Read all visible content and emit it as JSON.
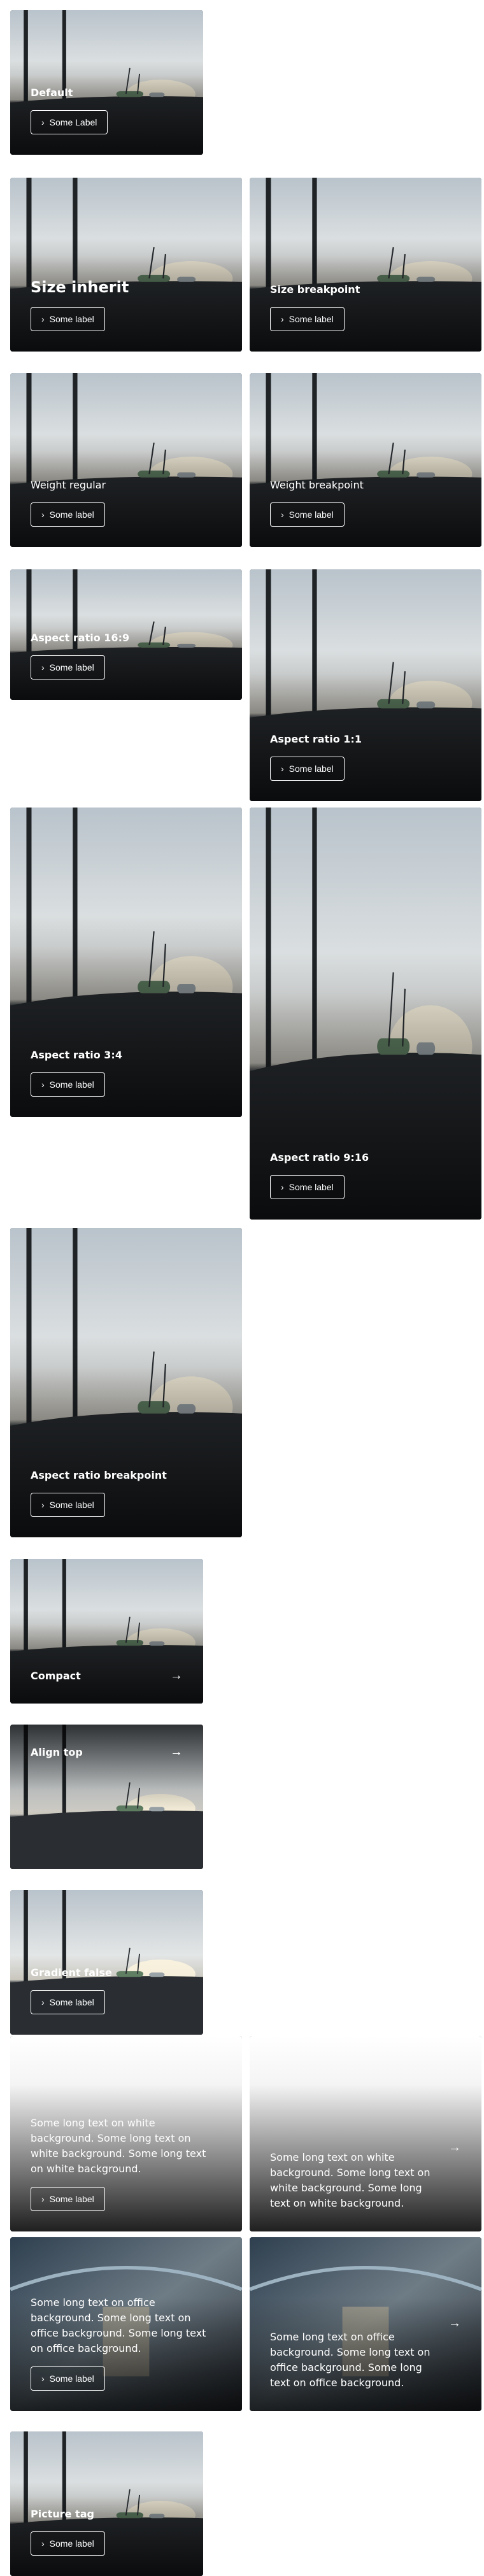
{
  "tiles": {
    "default": {
      "title": "Default",
      "button": "Some Label"
    },
    "size_inherit": {
      "title": "Size inherit",
      "button": "Some label"
    },
    "size_breakpoint": {
      "title": "Size breakpoint",
      "button": "Some label"
    },
    "weight_regular": {
      "title": "Weight regular",
      "button": "Some label"
    },
    "weight_breakpoint": {
      "title": "Weight breakpoint",
      "button": "Some label"
    },
    "ar_16_9": {
      "title": "Aspect ratio 16:9",
      "button": "Some label"
    },
    "ar_1_1": {
      "title": "Aspect ratio 1:1",
      "button": "Some label"
    },
    "ar_3_4": {
      "title": "Aspect ratio 3:4",
      "button": "Some label"
    },
    "ar_9_16": {
      "title": "Aspect ratio 9:16",
      "button": "Some label"
    },
    "ar_breakpoint": {
      "title": "Aspect ratio breakpoint",
      "button": "Some label"
    },
    "compact": {
      "title": "Compact",
      "icon": "arrow-right-icon"
    },
    "align_top": {
      "title": "Align top",
      "icon": "arrow-right-icon"
    },
    "gradient_false": {
      "title": "Gradient false",
      "button": "Some label"
    },
    "white_long": {
      "title": "Some long text on white background. Some long text on white background. Some long text on white background.",
      "button": "Some label"
    },
    "white_long_compact": {
      "title": "Some long text on white background. Some long text on white background. Some long text on white background."
    },
    "office_long": {
      "title": "Some long text on office background. Some long text on office background. Some long text on office background.",
      "button": "Some label"
    },
    "office_long_compact": {
      "title": "Some long text on office background. Some long text on office background. Some long text on office background."
    },
    "picture_tag": {
      "title": "Picture tag",
      "button": "Some label"
    }
  },
  "colors": {
    "sky": "#cfd6dc",
    "ground": "#2b2f33",
    "office": "#4a5561",
    "white_bg": "#ffffff"
  }
}
